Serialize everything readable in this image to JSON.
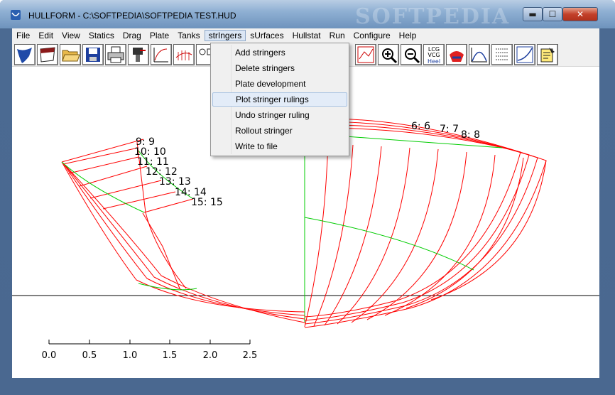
{
  "window": {
    "title": "HULLFORM - C:\\SOFTPEDIA\\SOFTPEDIA TEST.HUD",
    "watermark": "SOFTPEDIA",
    "minimize_glyph": "▬",
    "maximize_glyph": "☐",
    "close_glyph": "✕"
  },
  "menubar": {
    "items": [
      "File",
      "Edit",
      "View",
      "Statics",
      "Drag",
      "Plate",
      "Tanks",
      "strIngers",
      "sUrfaces",
      "Hullstat",
      "Run",
      "Configure",
      "Help"
    ],
    "active": "strIngers"
  },
  "toolbar": {
    "icons": [
      "hull-icon",
      "sheet-icon",
      "open-folder-icon",
      "save-disk-icon",
      "print-icon",
      "plotter-icon",
      "curve-icon",
      "section-icon",
      "shapes-icon",
      "graph-icon",
      "zoom-in-icon",
      "zoom-out-icon",
      "lcg-vcg-heel-icon",
      "stability-icon",
      "area-curve-icon",
      "table-icon",
      "speed-icon",
      "report-icon"
    ],
    "lcg_text": [
      "LCG",
      "VCG",
      "Heel"
    ]
  },
  "dropdown": {
    "items": [
      "Add stringers",
      "Delete stringers",
      "Plate development",
      "Plot stringer rulings",
      "Undo stringer ruling",
      "Rollout stringer",
      "Write to file"
    ],
    "highlighted": "Plot stringer rulings"
  },
  "drawing": {
    "left_labels": [
      "9: 9",
      "10: 10",
      "11: 11",
      "12: 12",
      "13: 13",
      "14: 14",
      "15: 15"
    ],
    "right_labels": [
      "6: 6",
      "7: 7",
      "8: 8"
    ],
    "scale_ticks": [
      "0.0",
      "0.5",
      "1.0",
      "1.5",
      "2.0",
      "2.5"
    ],
    "colors": {
      "hull": "#ff0000",
      "ruling": "#00cc00",
      "axis": "#000000"
    }
  }
}
